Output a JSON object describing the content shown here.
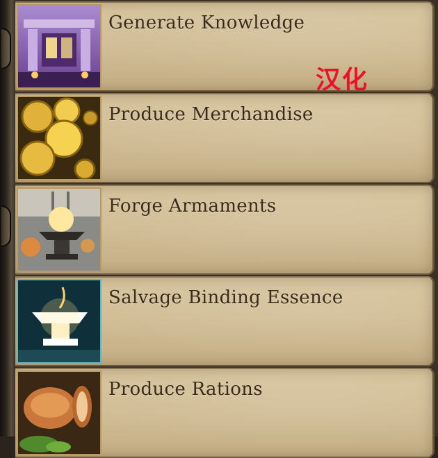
{
  "crafting_list": {
    "items": [
      {
        "label": "Generate Knowledge",
        "icon": "library-hall-icon"
      },
      {
        "label": "Produce Merchandise",
        "icon": "gold-coins-icon"
      },
      {
        "label": "Forge Armaments",
        "icon": "anvil-forge-icon"
      },
      {
        "label": "Salvage Binding Essence",
        "icon": "glowing-anvil-icon"
      },
      {
        "label": "Produce Rations",
        "icon": "bread-icon"
      }
    ]
  },
  "overlay": {
    "watermark_text": "汉化",
    "watermark_color": "#e8132a"
  },
  "colors": {
    "card_bg": "#d3c198",
    "title_text": "#3a2c1c",
    "thumb_border": "#b89a5f"
  }
}
